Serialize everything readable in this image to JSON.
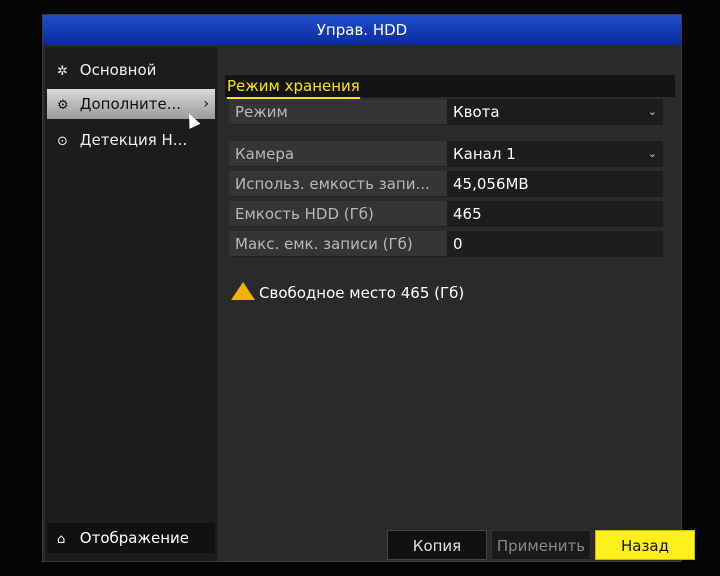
{
  "window": {
    "title": "Управ. HDD"
  },
  "sidebar": {
    "items": [
      {
        "label": "Основной",
        "icon": "gear-icon"
      },
      {
        "label": "Дополните...",
        "icon": "gears-icon"
      },
      {
        "label": "Детекция Н...",
        "icon": "shield-icon"
      }
    ],
    "bottom": {
      "label": "Отображение",
      "icon": "home-icon"
    }
  },
  "main": {
    "section_title": "Режим хранения",
    "mode_row": {
      "label": "Режим",
      "value": "Квота"
    },
    "rows": [
      {
        "label": "Камера",
        "value": "Канал 1"
      },
      {
        "label": "Использ. емкость запи...",
        "value": "45,056MB"
      },
      {
        "label": "Емкость HDD (Гб)",
        "value": "465"
      },
      {
        "label": "Макс. емк. записи (Гб)",
        "value": "0"
      }
    ],
    "warning": "Свободное место 465 (Гб)"
  },
  "buttons": {
    "copy": "Копия",
    "apply": "Применить",
    "back": "Назад"
  },
  "colors": {
    "title_bar": "#1e4fd0",
    "accent_yellow": "#ffe600",
    "warning": "#f2b400"
  }
}
